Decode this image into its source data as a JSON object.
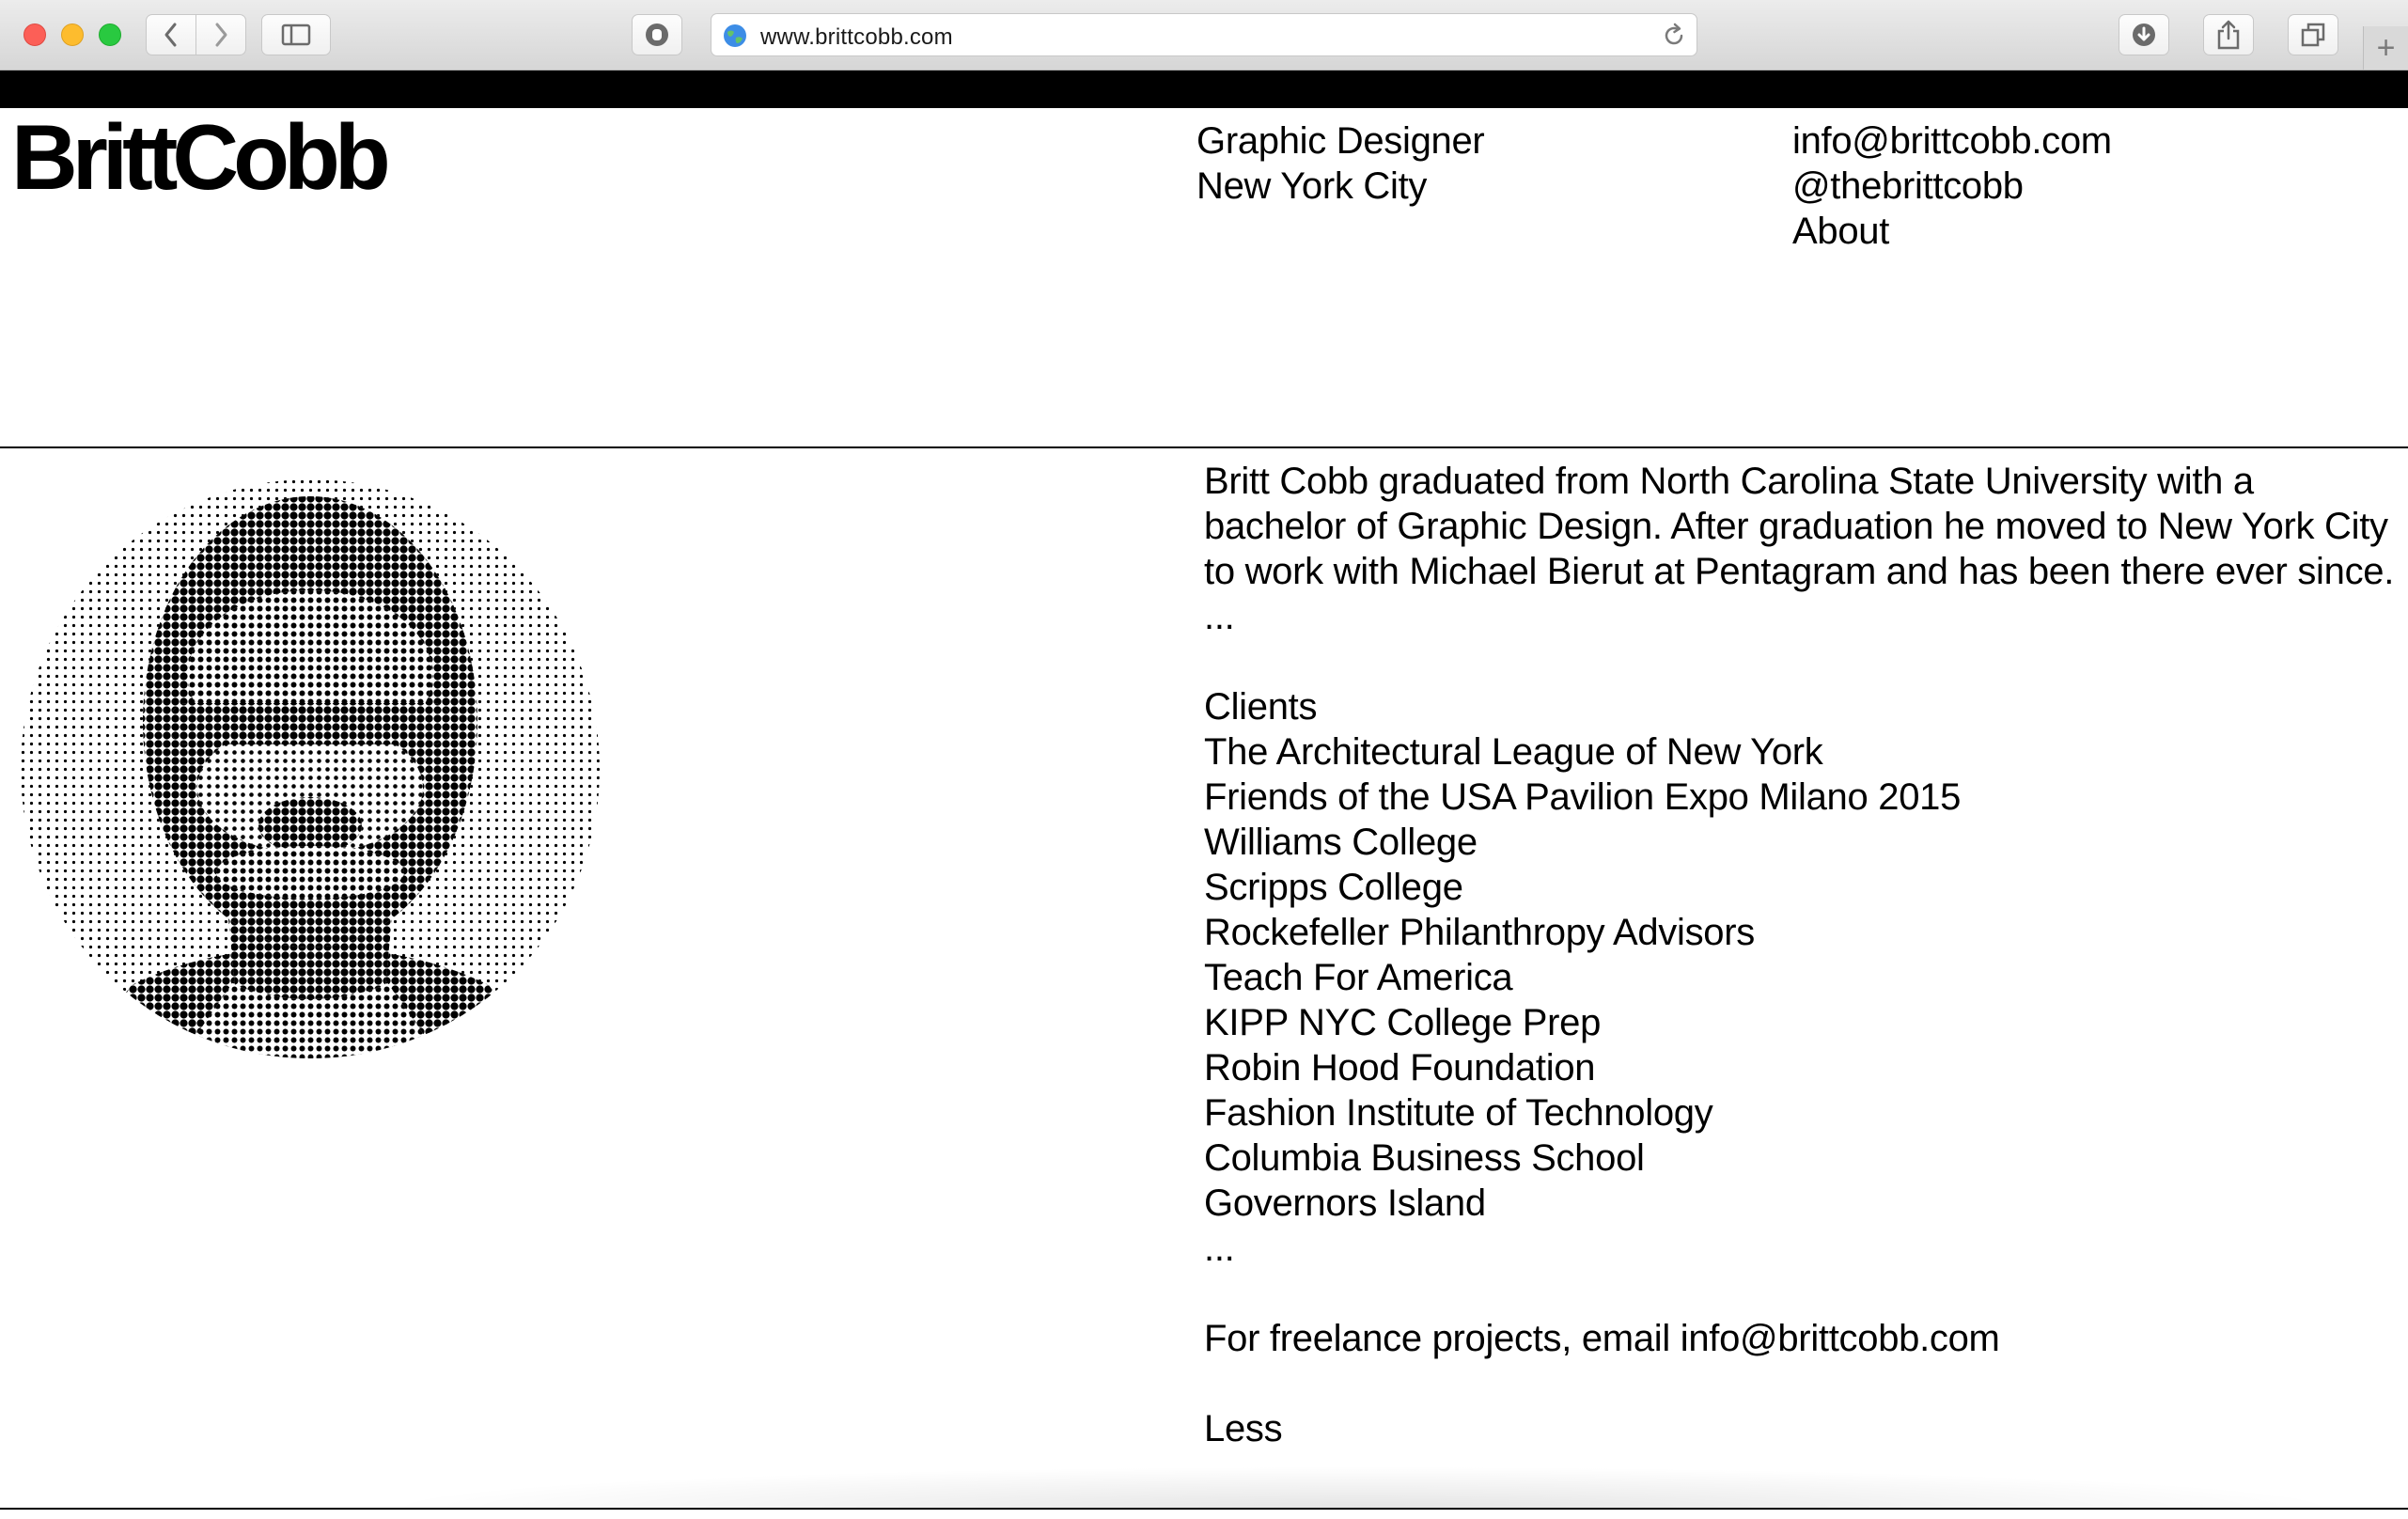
{
  "browser": {
    "url": "www.brittcobb.com",
    "new_tab_symbol": "+"
  },
  "header": {
    "logo": "BrittCobb",
    "role": "Graphic Designer",
    "location": "New York City",
    "email": "info@brittcobb.com",
    "handle": "@thebrittcobb",
    "about_link": "About"
  },
  "bio": {
    "paragraph": "Britt Cobb graduated from North Carolina State University with a bachelor of Graphic Design. After graduation he moved to New York City to work with Michael Bierut at Pentagram and has been there ever since.",
    "ellipsis_1": "...",
    "clients_heading": "Clients",
    "clients": [
      "The Architectural League of New York",
      "Friends of the USA Pavilion Expo Milano 2015",
      "Williams College",
      "Scripps College",
      "Rockefeller Philanthropy Advisors",
      "Teach For America",
      "KIPP NYC College Prep",
      "Robin Hood Foundation",
      "Fashion Institute of Technology",
      "Columbia Business School",
      "Governors Island"
    ],
    "ellipsis_2": "...",
    "freelance_prefix": "For freelance projects, email ",
    "freelance_email": "info@brittcobb.com",
    "less_link": "Less"
  },
  "icons": {
    "back": "chevron-left-icon",
    "forward": "chevron-right-icon",
    "sidebar": "sidebar-icon",
    "shield": "privacy-shield-icon",
    "globe": "globe-icon",
    "reload": "reload-icon",
    "downloads": "download-icon",
    "share": "share-icon",
    "tabs": "tabs-overview-icon"
  },
  "colors": {
    "close": "#fc5f57",
    "minimize": "#fdbc2e",
    "zoom": "#29c940",
    "band": "#000000",
    "text": "#000000"
  }
}
